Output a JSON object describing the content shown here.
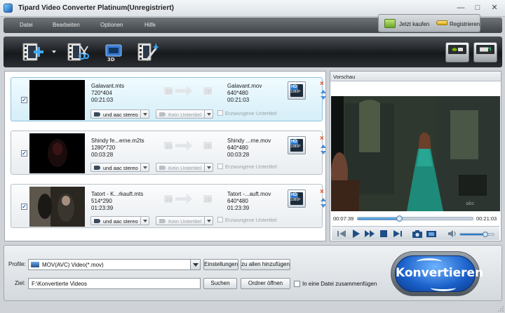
{
  "window": {
    "title": "Tipard Video Converter Platinum(Unregistriert)"
  },
  "menu": {
    "items": [
      "Datei",
      "Bearbeiten",
      "Optionen",
      "Hilfe"
    ],
    "buy_label": "Jetzt kaufen",
    "register_label": "Registrieren"
  },
  "toolbar": {
    "buttons": [
      "add-file",
      "clip",
      "3d",
      "edit-effect"
    ],
    "badges": [
      "NVIDIA CUDA",
      "AMD APP"
    ]
  },
  "files": [
    {
      "name": "Galavant.mts",
      "resolution": "720*404",
      "duration": "00:21:03",
      "out_name": "Galavant.mov",
      "out_resolution": "640*480",
      "out_duration": "00:21:03",
      "audio": "und aac stereo",
      "subtitle": "Kein Untertitel",
      "forced": "Erzwungene Untertitel",
      "checked": true,
      "selected": true
    },
    {
      "name": "Shindy fe...erne.m2ts",
      "resolution": "1280*720",
      "duration": "00:03:28",
      "out_name": "Shindy ...rne.mov",
      "out_resolution": "640*480",
      "out_duration": "00:03:28",
      "audio": "und aac stereo",
      "subtitle": "Kein Untertitel",
      "forced": "Erzwungene Untertitel",
      "checked": true,
      "selected": false
    },
    {
      "name": "Tatort - K...rkauft.mts",
      "resolution": "514*290",
      "duration": "01:23:39",
      "out_name": "Tatort -...auft.mov",
      "out_resolution": "640*480",
      "out_duration": "01:23:39",
      "audio": "und aac stereo",
      "subtitle": "Kein Untertitel",
      "forced": "Erzwungene Untertitel",
      "checked": true,
      "selected": false
    }
  ],
  "preview": {
    "title": "Vorschau",
    "current_time": "00:07:39",
    "total_time": "00:21:03",
    "progress": 0.36,
    "volume": 0.75
  },
  "bottom": {
    "profile_label": "Profile:",
    "profile_value": "MOV(AVC) Video(*.mov)",
    "settings_btn": "Einstellungen",
    "apply_all_btn": "zu allen hinzufügen",
    "dest_label": "Ziel:",
    "dest_value": "F:\\Konvertierte Videos",
    "browse_btn": "Suchen",
    "open_folder_btn": "Ordner öffnen",
    "merge_label": "In eine Datei zusammenfügen",
    "convert_btn": "Konvertieren"
  },
  "colors": {
    "accent": "#1a5fc9",
    "selected_row": "#d5eef8",
    "remove": "#e04b1a"
  }
}
